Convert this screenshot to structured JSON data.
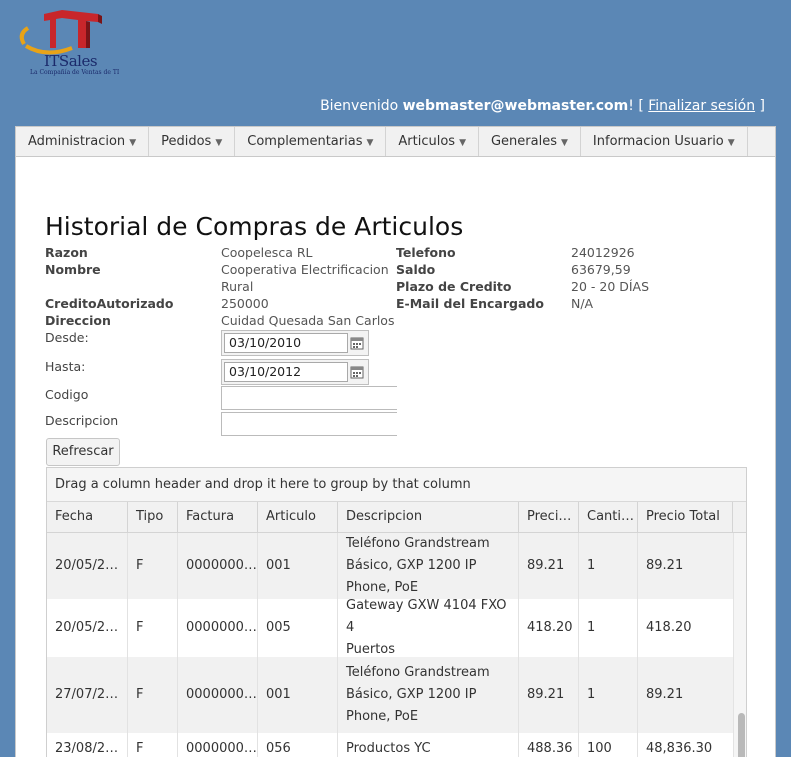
{
  "logo": {
    "brand": "ITSales",
    "tagline": "La Compañía de Ventas de TI"
  },
  "welcome": {
    "prefix": "Bienvenido ",
    "user": "webmaster@webmaster.com",
    "middle": "! [ ",
    "logout": "Finalizar sesión",
    "suffix": " ]"
  },
  "menu": [
    {
      "label": "Administracion"
    },
    {
      "label": "Pedidos"
    },
    {
      "label": "Complementarias"
    },
    {
      "label": "Articulos"
    },
    {
      "label": "Generales"
    },
    {
      "label": "Informacion Usuario"
    }
  ],
  "page_title": "Historial de Compras de Articulos",
  "details": {
    "razon_label": "Razon",
    "razon_value": "Coopelesca RL",
    "nombre_label": "Nombre",
    "nombre_value_1": "Cooperativa Electrificacion",
    "nombre_value_2": "Rural",
    "credito_label": "CreditoAutorizado",
    "credito_value": "250000",
    "direccion_label": "Direccion",
    "direccion_value": "Cuidad Quesada San Carlos",
    "telefono_label": "Telefono",
    "telefono_value": "24012926",
    "saldo_label": "Saldo",
    "saldo_value": "63679,59",
    "plazo_label": "Plazo de Credito",
    "plazo_value": "20 - 20 DÍAS",
    "email_label": "E-Mail del Encargado",
    "email_value": "N/A"
  },
  "filters": {
    "desde_label": "Desde:",
    "desde_value": "03/10/2010",
    "hasta_label": "Hasta:",
    "hasta_value": "03/10/2012",
    "codigo_label": "Codigo",
    "codigo_value": "",
    "descripcion_label": "Descripcion",
    "descripcion_value": ""
  },
  "refresh_label": "Refrescar",
  "grid": {
    "group_hint": "Drag a column header and drop it here to group by that column",
    "columns": [
      "Fecha",
      "Tipo",
      "Factura",
      "Articulo",
      "Descripcion",
      "Preci…",
      "Canti…",
      "Precio Total"
    ],
    "rows": [
      {
        "fecha": "20/05/2…",
        "tipo": "F",
        "factura": "0000000…",
        "articulo": "001",
        "desc1": "Teléfono Grandstream",
        "desc2": "Básico, GXP 1200 IP",
        "desc3": "Phone, PoE",
        "precio": "89.21",
        "cantidad": "1",
        "total": "89.21"
      },
      {
        "fecha": "20/05/2…",
        "tipo": "F",
        "factura": "0000000…",
        "articulo": "005",
        "desc1": "Gateway GXW 4104 FXO 4",
        "desc2": "Puertos",
        "desc3": "",
        "precio": "418.20",
        "cantidad": "1",
        "total": "418.20"
      },
      {
        "fecha": "27/07/2…",
        "tipo": "F",
        "factura": "0000000…",
        "articulo": "001",
        "desc1": "Teléfono Grandstream",
        "desc2": "Básico, GXP 1200 IP",
        "desc3": "Phone, PoE",
        "precio": "89.21",
        "cantidad": "1",
        "total": "89.21"
      },
      {
        "fecha": "23/08/2…",
        "tipo": "F",
        "factura": "0000000…",
        "articulo": "056",
        "desc1": "Productos YC",
        "desc2": "",
        "desc3": "",
        "precio": "488.36",
        "cantidad": "100",
        "total": "48,836.30"
      }
    ]
  },
  "colors": {
    "background": "#5b87b5",
    "panel": "#ffffff",
    "menu": "#f1f1f1",
    "alt_row": "#f1f1f1"
  }
}
